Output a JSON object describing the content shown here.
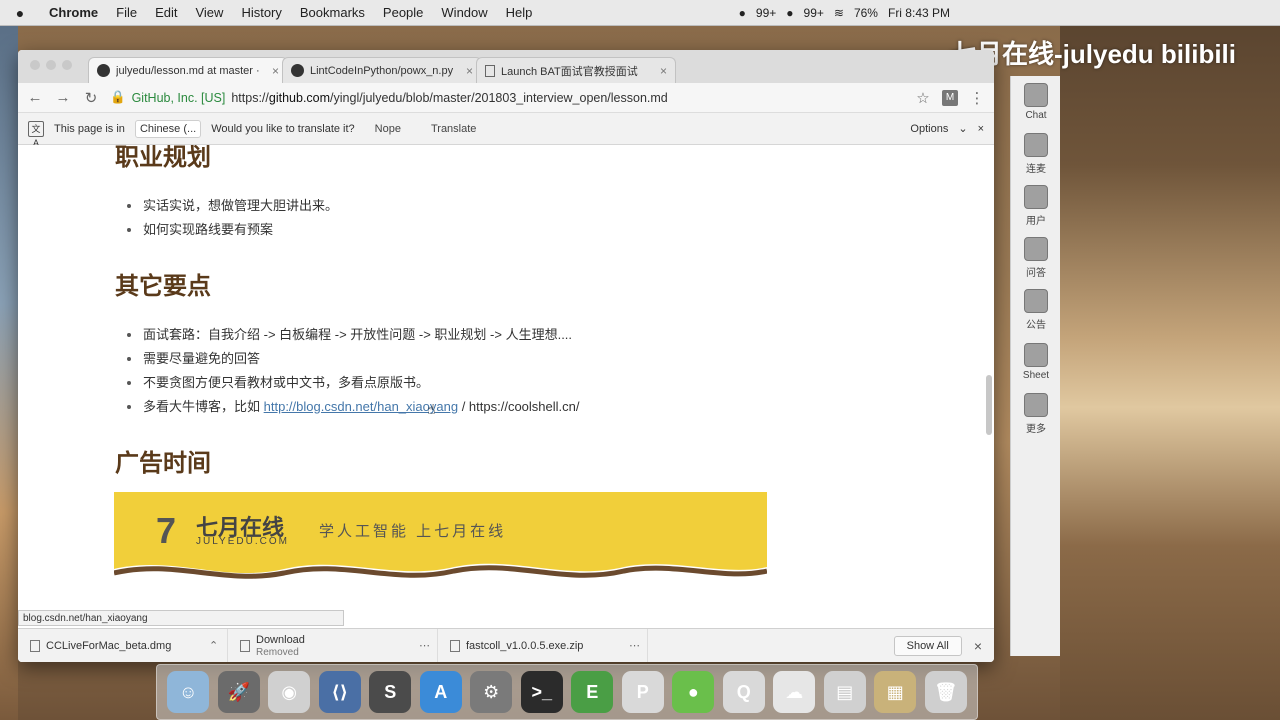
{
  "menubar": {
    "app": "Chrome",
    "items": [
      "File",
      "Edit",
      "View",
      "History",
      "Bookmarks",
      "People",
      "Window",
      "Help"
    ],
    "status": {
      "badge1": "99+",
      "badge2": "99+",
      "battery": "76%",
      "time": "Fri 8:43 PM"
    }
  },
  "watermark": "七月在线-julyedu  bilibili",
  "tabs": [
    {
      "title": "julyedu/lesson.md at master · ",
      "icon": "github-icon",
      "active": true
    },
    {
      "title": "LintCodeInPython/powx_n.py",
      "icon": "github-icon",
      "active": false
    },
    {
      "title": "Launch BAT面试官教授面试",
      "icon": "document-icon",
      "active": false
    }
  ],
  "toolbar": {
    "secure_label": "GitHub, Inc. [US]",
    "url_prefix": "https://",
    "url_host": "github.com",
    "url_path": "/yingl/julyedu/blob/master/201803_interview_open/lesson.md",
    "extension_label": "M"
  },
  "translate": {
    "text": "This page is in",
    "language": "Chinese (...",
    "question": "Would you like to translate it?",
    "nope": "Nope",
    "translate": "Translate",
    "options": "Options"
  },
  "article": {
    "section1": {
      "heading": "职业规划",
      "items": [
        "实话实说，想做管理大胆讲出来。",
        "如何实现路线要有预案"
      ]
    },
    "section2": {
      "heading": "其它要点",
      "items": [
        "面试套路：自我介绍 -> 白板编程 -> 开放性问题 -> 职业规划 -> 人生理想....",
        "需要尽量避免的回答",
        "不要贪图方便只看教材或中文书，多看点原版书。"
      ],
      "link_item": {
        "prefix": "多看大牛博客，比如",
        "link": "http://blog.csdn.net/han_xiaoyang",
        "separator": " / ",
        "suffix": "https://coolshell.cn/"
      }
    },
    "section3": {
      "heading": "广告时间"
    },
    "ad": {
      "logo_mark": "7",
      "logo_cn": "七月在线",
      "logo_en": "JULYEDU.COM",
      "slogan": "学人工智能 上七月在线",
      "bg_color": "#f1cf3a"
    }
  },
  "status_url": "blog.csdn.net/han_xiaoyang",
  "downloads": {
    "items": [
      {
        "name": "CCLiveForMac_beta.dmg",
        "sub": ""
      },
      {
        "name": "Download",
        "sub": "Removed"
      },
      {
        "name": "fastcoll_v1.0.0.5.exe.zip",
        "sub": ""
      }
    ],
    "show_all": "Show All"
  },
  "side_panel": [
    {
      "label": "Chat",
      "icon": "chat-icon"
    },
    {
      "label": "连麦",
      "icon": "mic-icon"
    },
    {
      "label": "用户",
      "icon": "user-icon"
    },
    {
      "label": "问答",
      "icon": "question-icon"
    },
    {
      "label": "公告",
      "icon": "announcement-icon"
    },
    {
      "label": "Sheet",
      "icon": "sheet-icon"
    },
    {
      "label": "更多",
      "icon": "more-icon"
    }
  ],
  "dock": [
    {
      "name": "finder",
      "color": "#8fb6d9",
      "glyph": "☺"
    },
    {
      "name": "launchpad",
      "color": "#6b6b6b",
      "glyph": "🚀"
    },
    {
      "name": "chrome",
      "color": "#d0d0d0",
      "glyph": "◉"
    },
    {
      "name": "vscode",
      "color": "#4a6fa5",
      "glyph": "⟨⟩"
    },
    {
      "name": "sublime",
      "color": "#4b4b4b",
      "glyph": "S"
    },
    {
      "name": "appstore",
      "color": "#3b8bd8",
      "glyph": "A"
    },
    {
      "name": "system-preferences",
      "color": "#7a7a7a",
      "glyph": "⚙"
    },
    {
      "name": "terminal",
      "color": "#2b2b2b",
      "glyph": ">_"
    },
    {
      "name": "evernote",
      "color": "#4a9e45",
      "glyph": "E"
    },
    {
      "name": "powerpoint",
      "color": "#d9d9d9",
      "glyph": "P"
    },
    {
      "name": "wechat",
      "color": "#6abf4b",
      "glyph": "●"
    },
    {
      "name": "qq",
      "color": "#d9d9d9",
      "glyph": "Q"
    },
    {
      "name": "cloud",
      "color": "#e6e6e6",
      "glyph": "☁"
    },
    {
      "name": "preview",
      "color": "#d0d0d0",
      "glyph": "▤"
    },
    {
      "name": "photos",
      "color": "#c9b27a",
      "glyph": "▦"
    },
    {
      "name": "trash",
      "color": "#cfcfcf",
      "glyph": "🗑"
    }
  ]
}
